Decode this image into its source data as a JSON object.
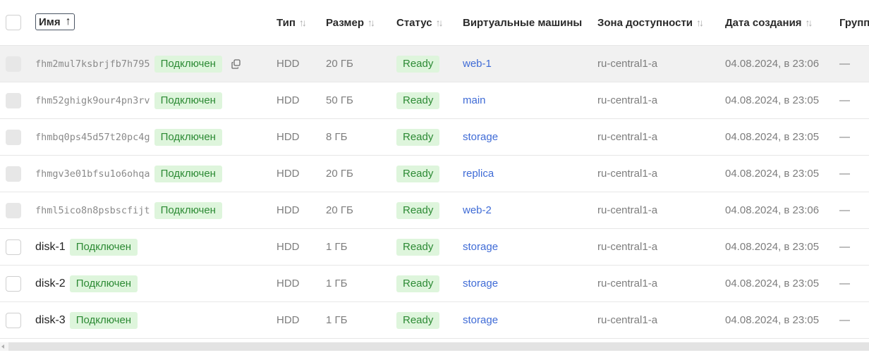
{
  "header": {
    "name": "Имя",
    "name_arrow": "↑",
    "type": "Тип",
    "size": "Размер",
    "status": "Статус",
    "vm": "Виртуальные машины",
    "zone": "Зона доступности",
    "date": "Дата создания",
    "group": "Групп",
    "sort_icon": "↑↓"
  },
  "rows": [
    {
      "id": "fhm2mul7ksbrjfb7h795",
      "badge": "Подключен",
      "type": "HDD",
      "size": "20 ГБ",
      "status": "Ready",
      "vm": "web-1",
      "zone": "ru-central1-a",
      "date": "04.08.2024, в 23:06",
      "group": "—"
    },
    {
      "id": "fhm52ghigk9our4pn3rv",
      "badge": "Подключен",
      "type": "HDD",
      "size": "50 ГБ",
      "status": "Ready",
      "vm": "main",
      "zone": "ru-central1-a",
      "date": "04.08.2024, в 23:05",
      "group": "—"
    },
    {
      "id": "fhmbq0ps45d57t20pc4g",
      "badge": "Подключен",
      "type": "HDD",
      "size": "8 ГБ",
      "status": "Ready",
      "vm": "storage",
      "zone": "ru-central1-a",
      "date": "04.08.2024, в 23:05",
      "group": "—"
    },
    {
      "id": "fhmgv3e01bfsu1o6ohqa",
      "badge": "Подключен",
      "type": "HDD",
      "size": "20 ГБ",
      "status": "Ready",
      "vm": "replica",
      "zone": "ru-central1-a",
      "date": "04.08.2024, в 23:05",
      "group": "—"
    },
    {
      "id": "fhml5ico8n8psbscfijt",
      "badge": "Подключен",
      "type": "HDD",
      "size": "20 ГБ",
      "status": "Ready",
      "vm": "web-2",
      "zone": "ru-central1-a",
      "date": "04.08.2024, в 23:06",
      "group": "—"
    },
    {
      "id": "disk-1",
      "badge": "Подключен",
      "type": "HDD",
      "size": "1 ГБ",
      "status": "Ready",
      "vm": "storage",
      "zone": "ru-central1-a",
      "date": "04.08.2024, в 23:05",
      "group": "—"
    },
    {
      "id": "disk-2",
      "badge": "Подключен",
      "type": "HDD",
      "size": "1 ГБ",
      "status": "Ready",
      "vm": "storage",
      "zone": "ru-central1-a",
      "date": "04.08.2024, в 23:05",
      "group": "—"
    },
    {
      "id": "disk-3",
      "badge": "Подключен",
      "type": "HDD",
      "size": "1 ГБ",
      "status": "Ready",
      "vm": "storage",
      "zone": "ru-central1-a",
      "date": "04.08.2024, в 23:05",
      "group": "—"
    }
  ],
  "colors": {
    "accent_link": "#3f6bd6",
    "status_bg": "#def5dc",
    "status_fg": "#2c8a34"
  }
}
